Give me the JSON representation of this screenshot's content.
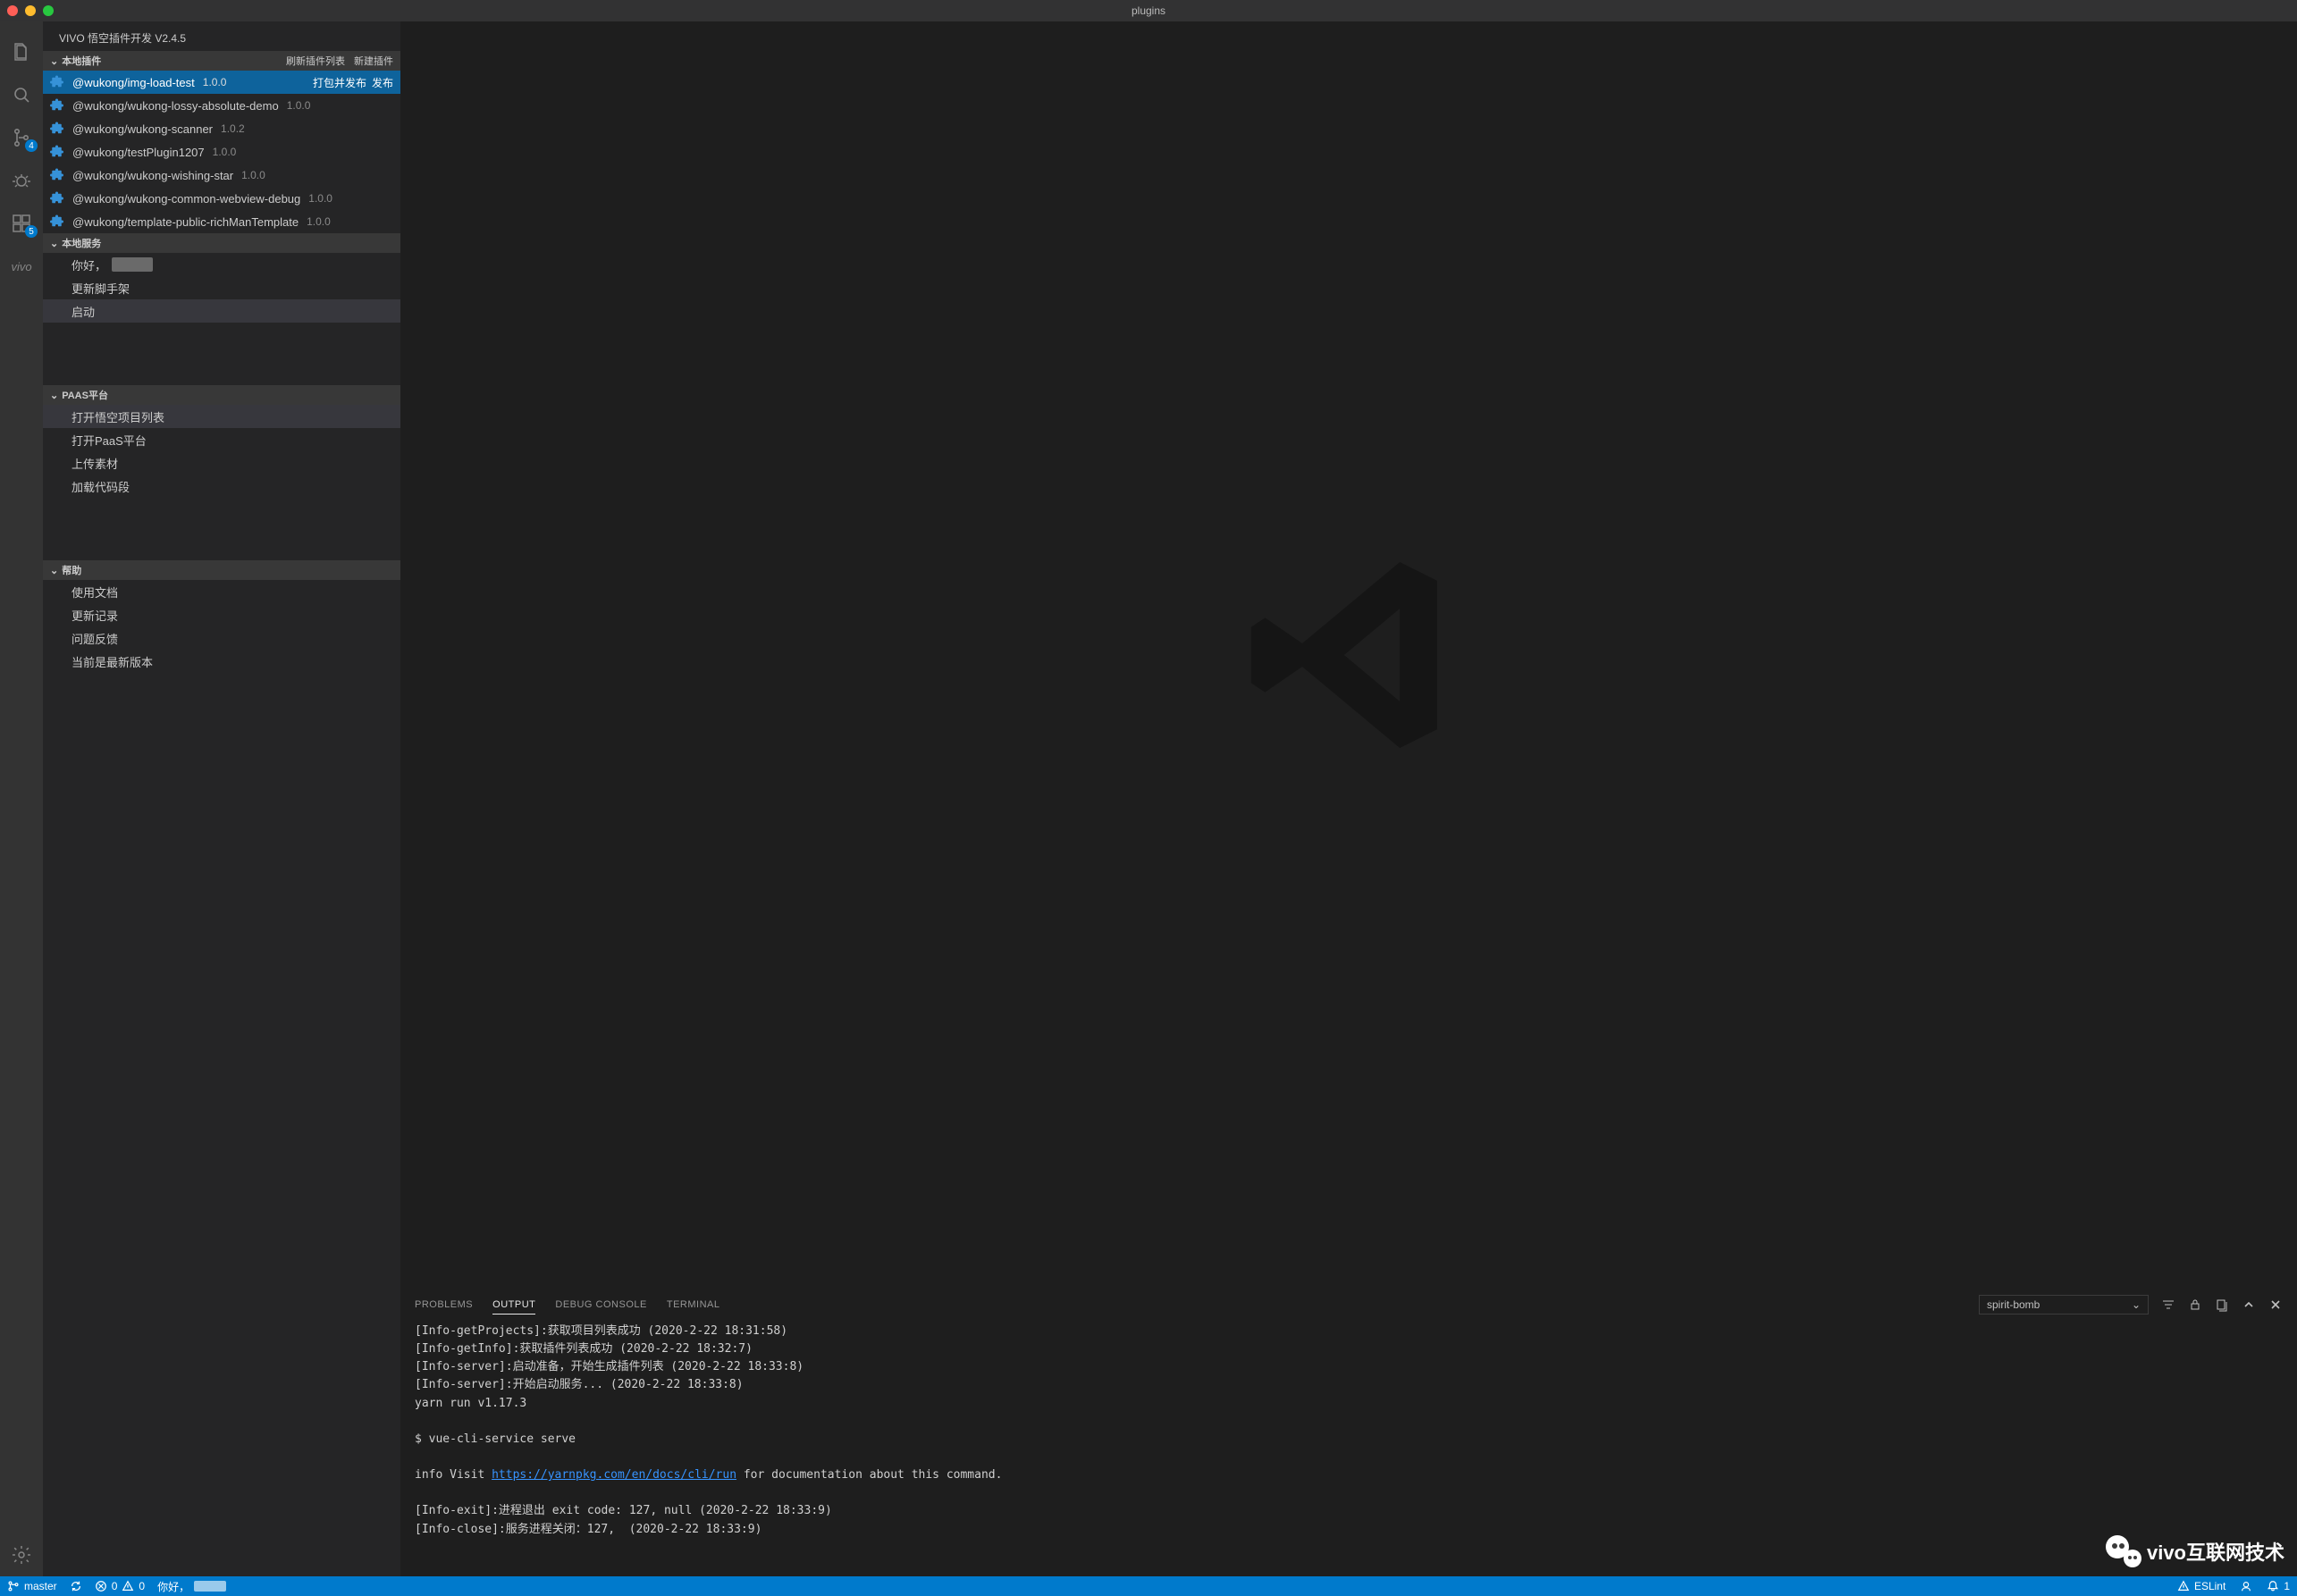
{
  "titlebar": {
    "title": "plugins"
  },
  "activitybar": {
    "badges": {
      "scm": "4",
      "extensions": "5"
    },
    "vivo": "vivo"
  },
  "sidebar": {
    "heading": "VIVO 悟空插件开发 V2.4.5",
    "sections": {
      "local_plugins": {
        "title": "本地插件",
        "actions": {
          "refresh": "刷新插件列表",
          "create": "新建插件"
        },
        "selected_actions": {
          "pack": "打包并发布",
          "publish": "发布"
        },
        "items": [
          {
            "name": "@wukong/img-load-test",
            "ver": "1.0.0",
            "selected": true
          },
          {
            "name": "@wukong/wukong-lossy-absolute-demo",
            "ver": "1.0.0"
          },
          {
            "name": "@wukong/wukong-scanner",
            "ver": "1.0.2"
          },
          {
            "name": "@wukong/testPlugin1207",
            "ver": "1.0.0"
          },
          {
            "name": "@wukong/wukong-wishing-star",
            "ver": "1.0.0"
          },
          {
            "name": "@wukong/wukong-common-webview-debug",
            "ver": "1.0.0"
          },
          {
            "name": "@wukong/template-public-richManTemplate",
            "ver": "1.0.0"
          }
        ]
      },
      "local_services": {
        "title": "本地服务",
        "items": [
          {
            "label": "你好，",
            "masked": true
          },
          {
            "label": "更新脚手架"
          },
          {
            "label": "启动",
            "highlight": true
          }
        ]
      },
      "paas": {
        "title": "PAAS平台",
        "items": [
          {
            "label": "打开悟空项目列表",
            "highlight": true
          },
          {
            "label": "打开PaaS平台"
          },
          {
            "label": "上传素材"
          },
          {
            "label": "加载代码段"
          }
        ]
      },
      "help": {
        "title": "帮助",
        "items": [
          {
            "label": "使用文档"
          },
          {
            "label": "更新记录"
          },
          {
            "label": "问题反馈"
          },
          {
            "label": "当前是最新版本"
          }
        ]
      }
    }
  },
  "panel": {
    "tabs": {
      "problems": "PROBLEMS",
      "output": "OUTPUT",
      "debug_console": "DEBUG CONSOLE",
      "terminal": "TERMINAL"
    },
    "select": "spirit-bomb",
    "output_lines": [
      "[Info-getProjects]:获取项目列表成功 (2020-2-22 18:31:58)",
      "[Info-getInfo]:获取插件列表成功 (2020-2-22 18:32:7)",
      "[Info-server]:启动准备，开始生成插件列表 (2020-2-22 18:33:8)",
      "[Info-server]:开始启动服务... (2020-2-22 18:33:8)",
      "yarn run v1.17.3",
      "",
      "$ vue-cli-service serve",
      "",
      "info Visit https://yarnpkg.com/en/docs/cli/run for documentation about this command.",
      "",
      "[Info-exit]:进程退出 exit code: 127, null (2020-2-22 18:33:9)",
      "[Info-close]:服务进程关闭：127,  (2020-2-22 18:33:9)"
    ],
    "link_text": "https://yarnpkg.com/en/docs/cli/run"
  },
  "statusbar": {
    "branch": "master",
    "errors": "0",
    "warnings": "0",
    "greeting": "你好，",
    "eslint": "ESLint",
    "bell": "1"
  },
  "watermark": "vivo互联网技术"
}
